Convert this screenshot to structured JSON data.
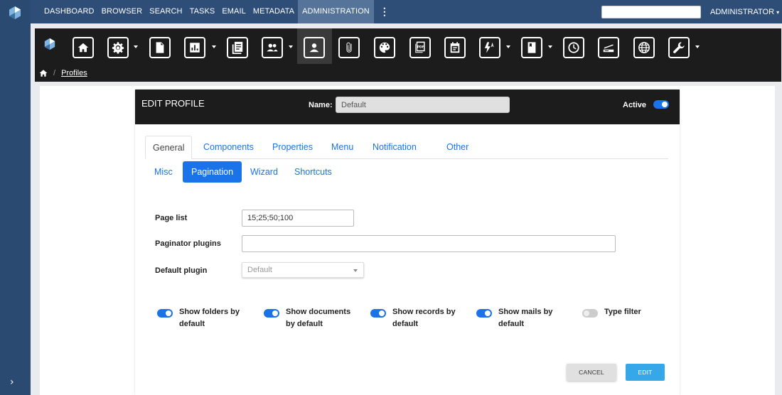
{
  "nav": {
    "items": [
      "DASHBOARD",
      "BROWSER",
      "SEARCH",
      "TASKS",
      "EMAIL",
      "METADATA",
      "ADMINISTRATION"
    ],
    "active": "ADMINISTRATION",
    "more": "⋮",
    "user_label": "ADMINISTRATOR",
    "search_value": ""
  },
  "toolbar": {
    "icons": [
      "home-icon",
      "settings-icon",
      "document-icon",
      "chart-icon",
      "list-icon",
      "users-icon",
      "profile-icon",
      "attachment-icon",
      "palette-icon",
      "pdf-icon",
      "calendar-icon",
      "automation-icon",
      "book-icon",
      "clock-icon",
      "scanner-icon",
      "globe-icon",
      "wrench-icon"
    ],
    "active": "profile-icon",
    "pdf_text": "PDF"
  },
  "breadcrumb": {
    "current": "Profiles"
  },
  "profile": {
    "title": "EDIT PROFILE",
    "name_label": "Name:",
    "name_value": "Default",
    "active_label": "Active",
    "active": true
  },
  "tabs": [
    "General",
    "Components",
    "Properties",
    "Menu",
    "Notification",
    "Other"
  ],
  "selected_tab": "General",
  "subtabs": [
    "Misc",
    "Pagination",
    "Wizard",
    "Shortcuts"
  ],
  "selected_subtab": "Pagination",
  "form": {
    "page_list_label": "Page list",
    "page_list_value": "15;25;50;100",
    "paginator_plugins_label": "Paginator plugins",
    "paginator_plugins_value": "",
    "default_plugin_label": "Default plugin",
    "default_plugin_value": "Default"
  },
  "options": [
    {
      "label": "Show folders by default",
      "on": true
    },
    {
      "label": "Show documents by default",
      "on": true
    },
    {
      "label": "Show records by default",
      "on": true
    },
    {
      "label": "Show mails by default",
      "on": true
    },
    {
      "label": "Type filter",
      "on": false
    }
  ],
  "buttons": {
    "cancel": "CANCEL",
    "edit": "EDIT"
  },
  "colors": {
    "nav_bg": "#2e4e78",
    "toolbar_bg": "#1c1c1c",
    "accent": "#1a73e8",
    "edit_button": "#36a7e8"
  }
}
